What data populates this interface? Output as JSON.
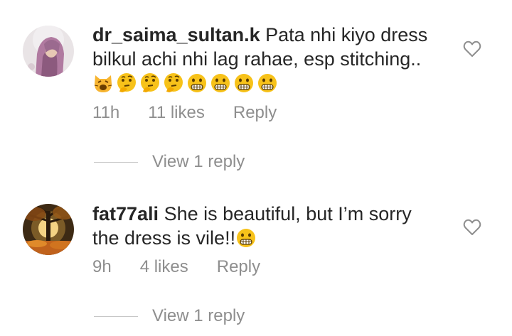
{
  "comments": [
    {
      "username": "dr_saima_sultan.k",
      "text_line1": " Pata nhi kiyo dress",
      "text_line2": "bilkul achi nhi lag rahae,  esp stitching..",
      "emojis": [
        "weary-cat-emoji",
        "thinking-face-emoji",
        "thinking-face-emoji",
        "thinking-face-emoji",
        "grimacing-face-emoji",
        "grimacing-face-emoji",
        "grimacing-face-emoji",
        "grimacing-face-emoji"
      ],
      "time": "11h",
      "likes": "11 likes",
      "reply": "Reply",
      "view_replies": "View 1 reply",
      "avatar_icon": "profile-photo-purple-scarf"
    },
    {
      "username": "fat77ali",
      "text_line1": " She is beautiful, but I’m sorry",
      "text_line2": "the dress is vile!!",
      "emojis": [
        "grimacing-face-emoji"
      ],
      "time": "9h",
      "likes": "4 likes",
      "reply": "Reply",
      "view_replies": "View 1 reply",
      "avatar_icon": "profile-photo-autumn-tree"
    }
  ],
  "colors": {
    "text": "#262626",
    "secondary": "#8e8e8e",
    "divider": "#c7c7c7",
    "emoji_yellow": "#f7c21a"
  }
}
